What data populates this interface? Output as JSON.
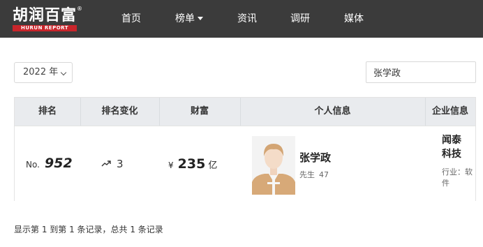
{
  "nav": {
    "logo_cn": "胡润百富",
    "logo_en": "HURUN REPORT",
    "logo_reg": "®",
    "items": [
      {
        "label": "首页"
      },
      {
        "label": "榜单"
      },
      {
        "label": "资讯"
      },
      {
        "label": "调研"
      },
      {
        "label": "媒体"
      }
    ],
    "bg_color": "#3b3b3b",
    "logo_badge_color": "#c9252b"
  },
  "filters": {
    "year": "2022 年",
    "search_value": "张学政"
  },
  "table": {
    "headers": [
      "排名",
      "排名变化",
      "财富",
      "个人信息",
      "企业信息"
    ],
    "rows": [
      {
        "rank_prefix": "No.",
        "rank": "952",
        "rank_change": "3",
        "rank_change_icon": "trending-up-icon",
        "currency": "¥",
        "wealth": "235",
        "wealth_unit": "亿",
        "name": "张学政",
        "title": "先生",
        "age": "47",
        "company": "闻泰科技",
        "industry_label": "行业：",
        "industry": "软件"
      }
    ]
  },
  "footer": {
    "summary": "显示第 1 到第 1 条记录，总共 1 条记录"
  }
}
